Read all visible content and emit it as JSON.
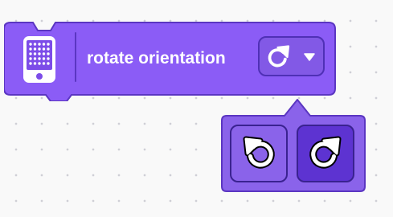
{
  "block": {
    "label": "rotate orientation",
    "device_icon": "phone-dot-grid-icon",
    "dropdown": {
      "selected_icon": "rotate-clockwise-icon",
      "caret_icon": "caret-down-icon"
    }
  },
  "popup": {
    "options": [
      {
        "icon": "rotate-counterclockwise-icon"
      },
      {
        "icon": "rotate-clockwise-icon"
      }
    ]
  },
  "colors": {
    "block_fill": "#8b5cf6",
    "block_stroke": "#5b36c2",
    "dropdown_fill": "#8259e6",
    "popup_fill": "#8a63ea",
    "option_selected_fill": "#5d33d1",
    "icon_white": "#ffffff",
    "background": "#f9f9f9"
  }
}
